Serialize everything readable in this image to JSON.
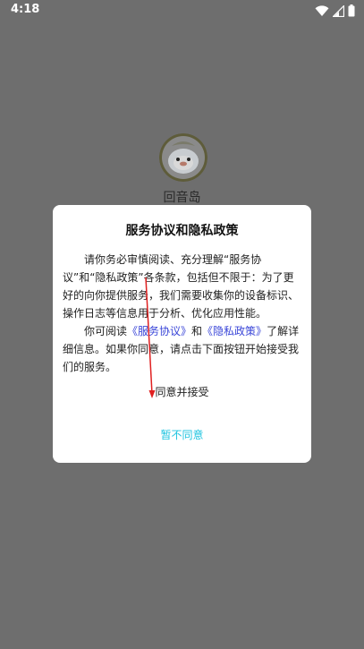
{
  "status_bar": {
    "time": "4:18"
  },
  "app": {
    "name": "回音岛"
  },
  "dialog": {
    "title": "服务协议和隐私政策",
    "para1": "请你务必审慎阅读、充分理解“服务协议”和“隐私政策”各条款，包括但不限于：为了更好的向你提供服务，我们需要收集你的设备标识、操作日志等信息用于分析、优化应用性能。",
    "para2_prefix": "你可阅读",
    "link_service": "《服务协议》",
    "para2_and": "和",
    "link_privacy": "《隐私政策》",
    "para2_suffix": "了解详细信息。如果你同意，请点击下面按钮开始接受我们的服务。",
    "accept_label": "同意并接受",
    "decline_label": "暂不同意"
  },
  "colors": {
    "overlay": "#6e6e6e",
    "link": "#3a46d8",
    "decline": "#20c4e0",
    "arrow": "#e02020"
  }
}
